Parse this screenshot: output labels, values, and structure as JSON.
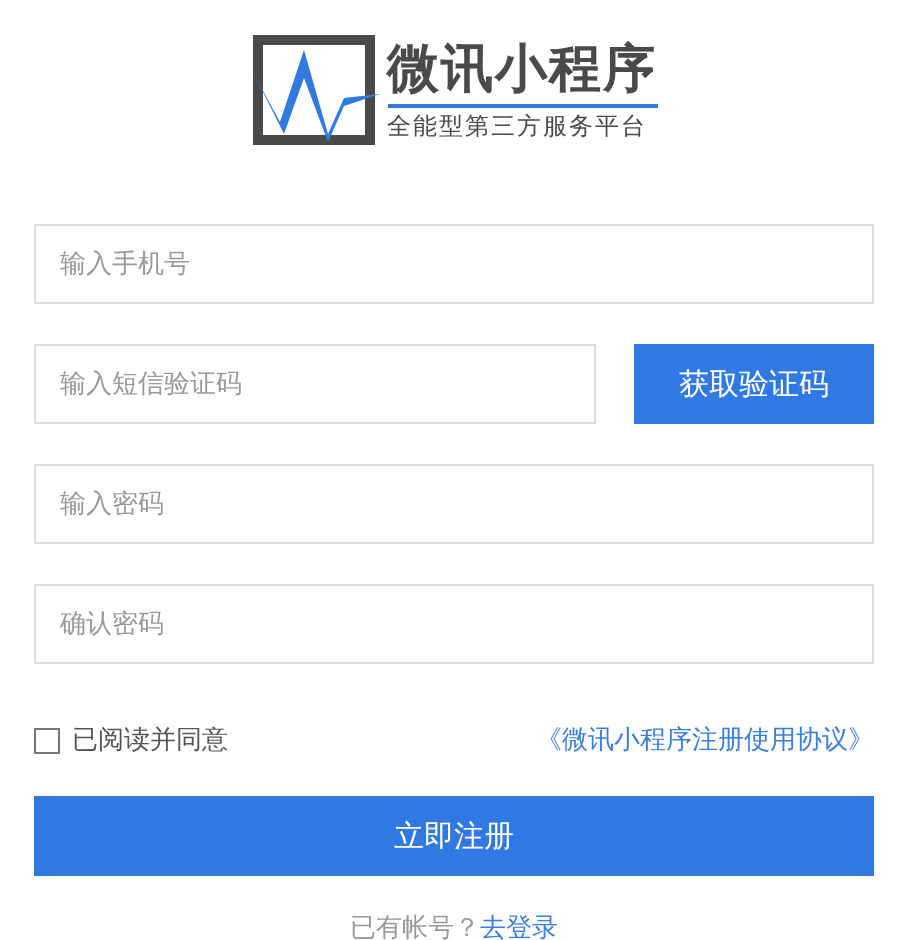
{
  "logo": {
    "title": "微讯小程序",
    "subtitle": "全能型第三方服务平台"
  },
  "fields": [
    {
      "kind": "plain",
      "placeholder": "输入手机号"
    },
    {
      "kind": "code",
      "placeholder": "输入短信验证码",
      "button": "获取验证码"
    },
    {
      "kind": "password",
      "placeholder": "输入密码"
    },
    {
      "kind": "password",
      "placeholder": "确认密码"
    }
  ],
  "agreement": {
    "checked": false,
    "label": "已阅读并同意",
    "link": "《微讯小程序注册使用协议》"
  },
  "submit": "立即注册",
  "footer": {
    "text": "已有帐号？",
    "link": "去登录"
  }
}
